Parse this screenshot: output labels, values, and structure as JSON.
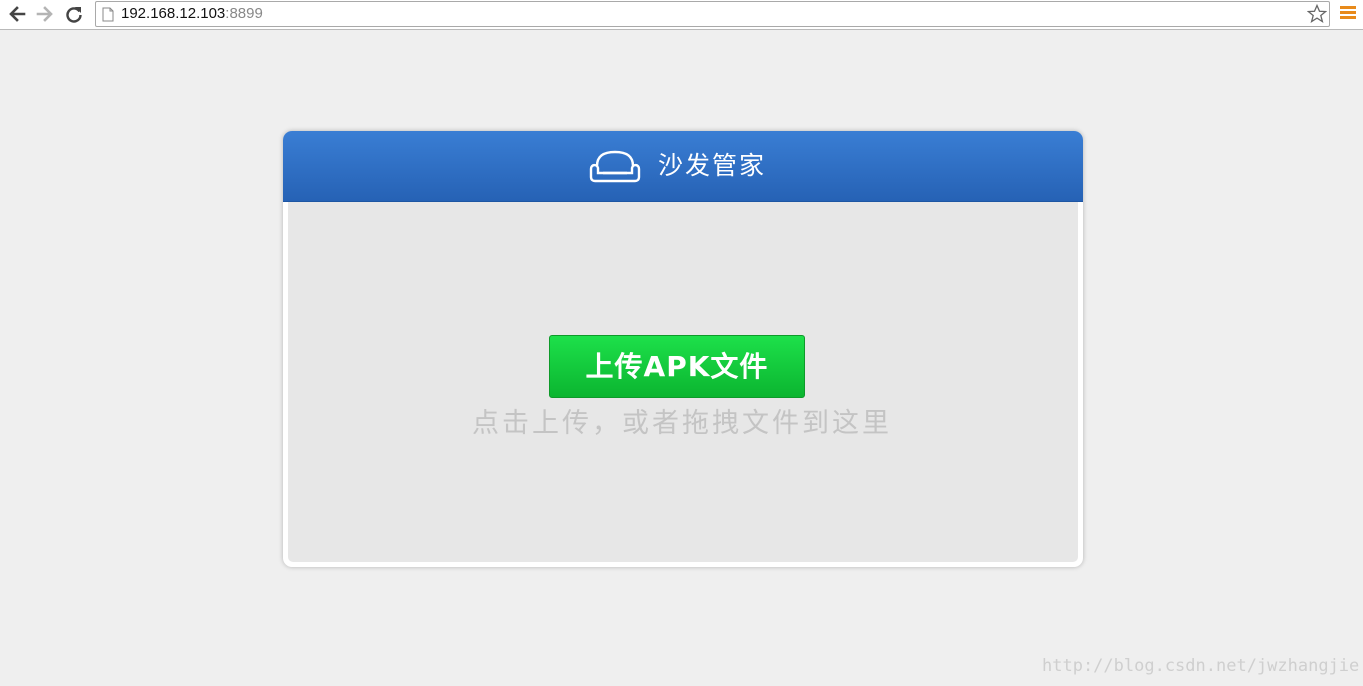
{
  "browser": {
    "url_host": "192.168.12.103",
    "url_port": ":8899",
    "icons": {
      "back": "back-arrow-icon",
      "forward": "forward-arrow-icon",
      "reload": "reload-icon",
      "page": "page-icon",
      "bookmark": "star-icon",
      "menu": "menu-icon"
    }
  },
  "app": {
    "title": "沙发管家",
    "logo_icon": "sofa-icon",
    "header_color": "#2e70c6",
    "upload_button_label": "上传APK文件",
    "upload_button_color": "#14c83c",
    "upload_hint": "点击上传，或者拖拽文件到这里"
  },
  "watermark": "http://blog.csdn.net/jwzhangjie"
}
